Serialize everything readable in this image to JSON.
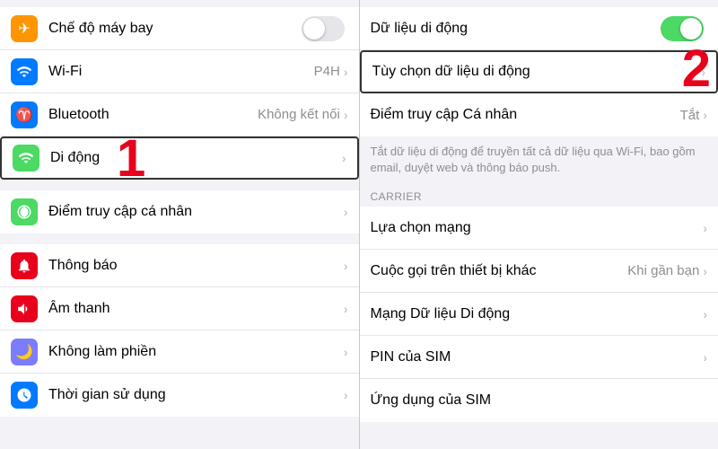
{
  "left": {
    "groups": [
      {
        "rows": [
          {
            "id": "airplane",
            "icon_bg": "icon-airplane",
            "icon": "✈",
            "label": "Chế độ máy bay",
            "value": "",
            "toggle": true,
            "toggle_on": false,
            "chevron": false
          },
          {
            "id": "wifi",
            "icon_bg": "icon-wifi",
            "icon": "📶",
            "label": "Wi-Fi",
            "value": "P4H",
            "toggle": false,
            "chevron": true
          },
          {
            "id": "bluetooth",
            "icon_bg": "icon-bluetooth",
            "icon": "🔵",
            "label": "Bluetooth",
            "value": "Không kết nối",
            "toggle": false,
            "chevron": true
          },
          {
            "id": "cellular",
            "icon_bg": "icon-cellular",
            "icon": "📡",
            "label": "Di động",
            "value": "",
            "toggle": false,
            "chevron": true,
            "highlighted": true
          }
        ]
      },
      {
        "rows": [
          {
            "id": "hotspot",
            "icon_bg": "icon-hotspot",
            "icon": "🔗",
            "label": "Điểm truy cập cá nhân",
            "value": "",
            "toggle": false,
            "chevron": true
          }
        ]
      },
      {
        "rows": [
          {
            "id": "notifications",
            "icon_bg": "icon-notifications",
            "icon": "🔔",
            "label": "Thông báo",
            "value": "",
            "toggle": false,
            "chevron": true
          },
          {
            "id": "sounds",
            "icon_bg": "icon-sounds",
            "icon": "🔊",
            "label": "Âm thanh",
            "value": "",
            "toggle": false,
            "chevron": true
          },
          {
            "id": "donotdisturb",
            "icon_bg": "icon-donotdisturb",
            "icon": "🌙",
            "label": "Không làm phiền",
            "value": "",
            "toggle": false,
            "chevron": true
          },
          {
            "id": "screentime",
            "icon_bg": "icon-screentime",
            "icon": "⏳",
            "label": "Thời gian sử dụng",
            "value": "",
            "toggle": false,
            "chevron": true
          }
        ]
      }
    ],
    "badge": "1"
  },
  "right": {
    "top_rows": [
      {
        "id": "cellular-data",
        "label": "Dữ liệu di động",
        "value": "",
        "toggle": true,
        "toggle_on": true,
        "chevron": false
      },
      {
        "id": "cellular-data-options",
        "label": "Tùy chọn dữ liệu di động",
        "value": "",
        "toggle": false,
        "chevron": true,
        "highlighted": true
      },
      {
        "id": "personal-hotspot",
        "label": "Điểm truy cập Cá nhân",
        "value": "Tắt",
        "toggle": false,
        "chevron": true
      }
    ],
    "info_text": "Tắt dữ liệu di động để truyền tất cả dữ liệu qua Wi-Fi, bao gồm email, duyệt web và thông báo push.",
    "carrier_label": "CARRIER",
    "carrier_rows": [
      {
        "id": "network-select",
        "label": "Lựa chọn mạng",
        "value": "",
        "chevron": true
      },
      {
        "id": "wifi-calling",
        "label": "Cuộc gọi trên thiết bị khác",
        "value": "Khi gần bạn",
        "chevron": true
      },
      {
        "id": "mobile-data-network",
        "label": "Mạng Dữ liệu Di động",
        "value": "",
        "chevron": true
      },
      {
        "id": "sim-pin",
        "label": "PIN của SIM",
        "value": "",
        "chevron": true
      },
      {
        "id": "sim-app",
        "label": "Ứng dụng của SIM",
        "value": "",
        "chevron": false,
        "partial": true
      }
    ],
    "badge": "2"
  }
}
